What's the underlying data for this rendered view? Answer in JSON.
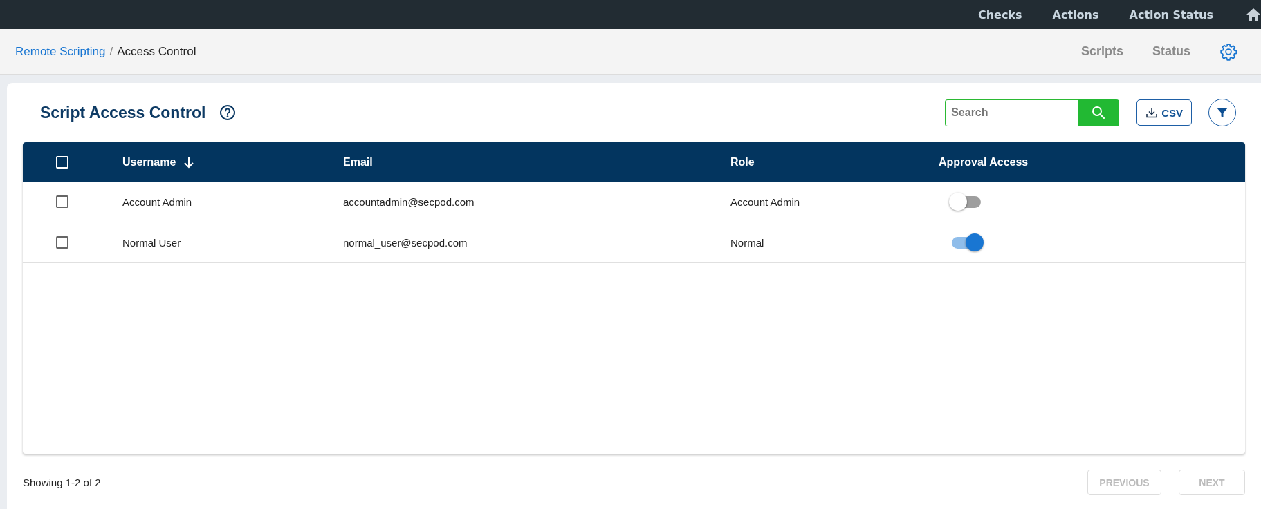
{
  "top_nav": {
    "items": [
      {
        "label": "Checks"
      },
      {
        "label": "Actions"
      },
      {
        "label": "Action Status"
      }
    ]
  },
  "breadcrumb": {
    "separator": "/",
    "items": [
      {
        "label": "Remote Scripting",
        "link": true
      },
      {
        "label": "Access Control",
        "link": false
      }
    ]
  },
  "sub_nav": {
    "items": [
      {
        "label": "Scripts"
      },
      {
        "label": "Status"
      }
    ]
  },
  "panel": {
    "title": "Script Access Control",
    "search": {
      "placeholder": "Search"
    },
    "csv_button": {
      "label": "CSV"
    }
  },
  "table": {
    "columns": [
      {
        "label": "Username",
        "sorted_desc": true
      },
      {
        "label": "Email",
        "sorted_desc": false
      },
      {
        "label": "Role",
        "sorted_desc": false
      },
      {
        "label": "Approval Access",
        "sorted_desc": false
      }
    ],
    "header_checked": false,
    "rows": [
      {
        "checked": false,
        "username": "Account Admin",
        "email": "accountadmin@secpod.com",
        "role": "Account Admin",
        "approval_access": false
      },
      {
        "checked": false,
        "username": "Normal User",
        "email": "normal_user@secpod.com",
        "role": "Normal",
        "approval_access": true
      }
    ]
  },
  "footer": {
    "summary": "Showing 1-2 of 2",
    "buttons": [
      {
        "label": "PREVIOUS",
        "disabled": true
      },
      {
        "label": "NEXT",
        "disabled": true
      }
    ]
  }
}
